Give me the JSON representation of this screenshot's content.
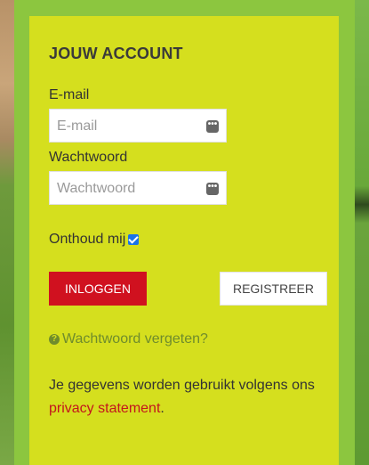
{
  "account": {
    "title": "JOUW ACCOUNT",
    "email_label": "E-mail",
    "email_placeholder": "E-mail",
    "password_label": "Wachtwoord",
    "password_placeholder": "Wachtwoord",
    "remember_label": "Onthoud mij",
    "remember_checked": true,
    "login_label": "INLOGGEN",
    "register_label": "REGISTREER",
    "forgot_label": "Wachtwoord vergeten?",
    "privacy_prefix": "Je gegevens worden gebruikt volgens ons ",
    "privacy_link": "privacy statement",
    "privacy_suffix": "."
  },
  "colors": {
    "card": "#d5df1e",
    "panel": "#8cc63f",
    "login_button": "#d0111f",
    "link": "#c3161c"
  },
  "icons": [
    "key-icon",
    "checkbox-checked-icon",
    "question-circle-icon"
  ]
}
